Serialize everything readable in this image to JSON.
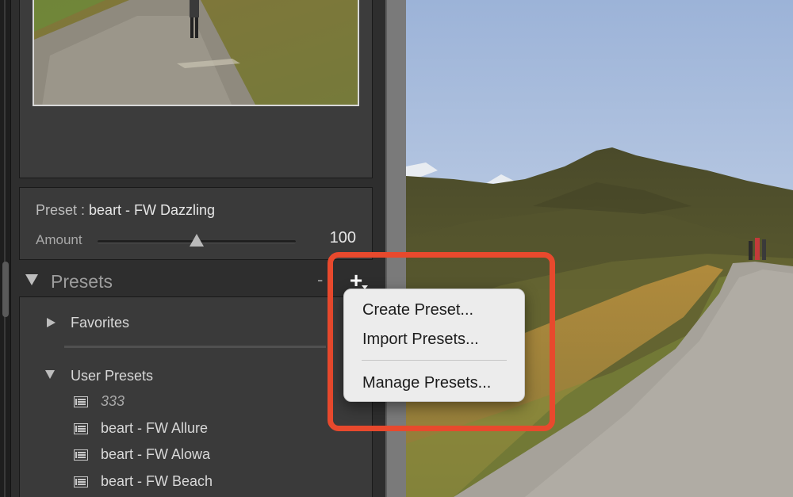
{
  "preset_info": {
    "prefix": "Preset : ",
    "name": "beart - FW Dazzling",
    "amount_label": "Amount",
    "amount_value": "100",
    "amount_fraction": 0.5
  },
  "presets_panel": {
    "title": "Presets",
    "minus_symbol": "-",
    "plus_symbol": "+",
    "favorites_label": "Favorites",
    "user_presets_label": "User Presets",
    "items": [
      {
        "label": "333",
        "italic": true
      },
      {
        "label": "beart - FW Allure",
        "italic": false
      },
      {
        "label": "beart - FW Alowa",
        "italic": false
      },
      {
        "label": "beart - FW Beach",
        "italic": false
      }
    ]
  },
  "context_menu": {
    "create": "Create Preset...",
    "import": "Import Presets...",
    "manage": "Manage Presets..."
  },
  "colors": {
    "highlight": "#e8492d",
    "panel_bg": "#2e2e2e",
    "menu_bg": "#ececec"
  },
  "icons": [
    "disclosure-triangle-icon",
    "preset-list-icon",
    "plus-icon",
    "minus-icon",
    "slider-thumb-icon"
  ]
}
